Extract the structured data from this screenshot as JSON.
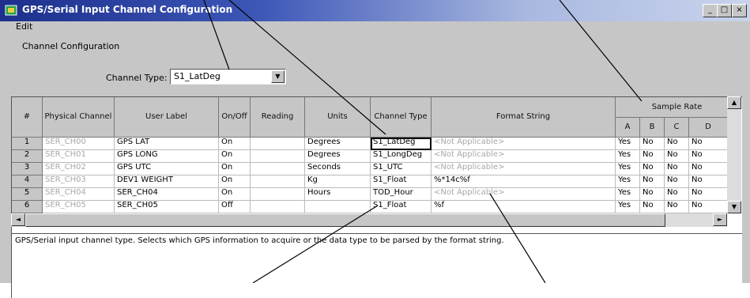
{
  "window": {
    "title": "GPS/Serial Input Channel Configuration"
  },
  "menu": {
    "edit": "Edit"
  },
  "group": {
    "label": "Channel Configuration"
  },
  "channel_type": {
    "label": "Channel Type:",
    "value": "S1_LatDeg"
  },
  "columns": [
    "#",
    "Physical Channel",
    "User Label",
    "On/Off",
    "Reading",
    "Units",
    "Channel Type",
    "Format String"
  ],
  "sample_rate": {
    "label": "Sample Rate",
    "cols": [
      "A",
      "B",
      "C",
      "D"
    ]
  },
  "rows": [
    {
      "num": "1",
      "physical": "SER_CH00",
      "label": "GPS LAT",
      "onoff": "On",
      "reading": "",
      "units": "Degrees",
      "type": "S1_LatDeg",
      "format": "<Not Applicable>",
      "a": "Yes",
      "b": "No",
      "c": "No",
      "d": "No"
    },
    {
      "num": "2",
      "physical": "SER_CH01",
      "label": "GPS LONG",
      "onoff": "On",
      "reading": "",
      "units": "Degrees",
      "type": "S1_LongDeg",
      "format": "<Not Applicable>",
      "a": "Yes",
      "b": "No",
      "c": "No",
      "d": "No"
    },
    {
      "num": "3",
      "physical": "SER_CH02",
      "label": "GPS UTC",
      "onoff": "On",
      "reading": "",
      "units": "Seconds",
      "type": "S1_UTC",
      "format": "<Not Applicable>",
      "a": "Yes",
      "b": "No",
      "c": "No",
      "d": "No"
    },
    {
      "num": "4",
      "physical": "SER_CH03",
      "label": "DEV1 WEIGHT",
      "onoff": "On",
      "reading": "",
      "units": "Kg",
      "type": "S1_Float",
      "format": "%*14c%f",
      "a": "Yes",
      "b": "No",
      "c": "No",
      "d": "No"
    },
    {
      "num": "5",
      "physical": "SER_CH04",
      "label": "SER_CH04",
      "onoff": "On",
      "reading": "",
      "units": "Hours",
      "type": "TOD_Hour",
      "format": "<Not Applicable>",
      "a": "Yes",
      "b": "No",
      "c": "No",
      "d": "No"
    },
    {
      "num": "6",
      "physical": "SER_CH05",
      "label": "SER_CH05",
      "onoff": "Off",
      "reading": "",
      "units": "",
      "type": "S1_Float",
      "format": "%f",
      "a": "Yes",
      "b": "No",
      "c": "No",
      "d": "No"
    }
  ],
  "status": {
    "text": "GPS/Serial input channel type. Selects which GPS information to acquire or the data type to be parsed by the format string."
  },
  "icons": {
    "window": "window-icon",
    "minimize": "minimize-icon",
    "maximize": "maximize-icon",
    "close": "close-icon",
    "dropdown": "chevron-down-icon"
  }
}
